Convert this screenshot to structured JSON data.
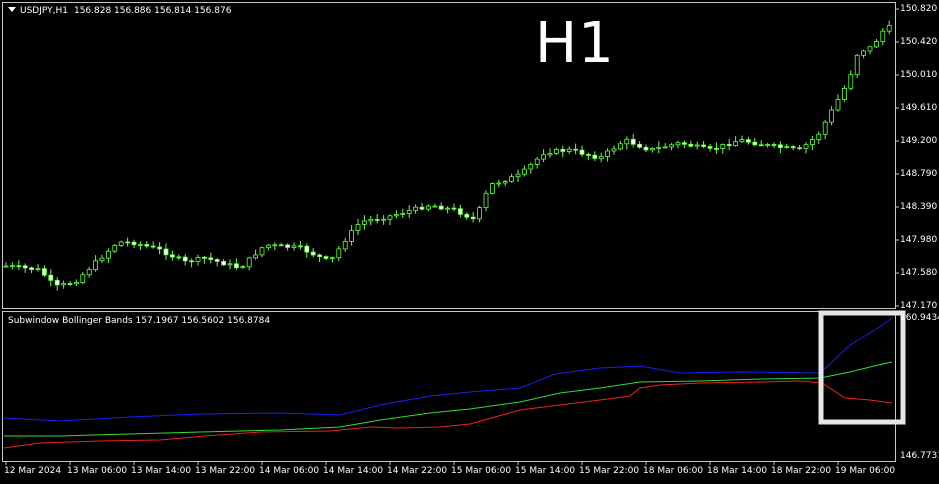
{
  "main_chart": {
    "symbol": "USDJPY,H1",
    "ohlc": "156.828 156.886 156.814 156.876",
    "timeframe_label": "H1",
    "y_ticks": [
      "150.820",
      "150.420",
      "150.010",
      "149.610",
      "149.200",
      "148.790",
      "148.390",
      "147.980",
      "147.580",
      "147.170"
    ]
  },
  "subwindow": {
    "title": "Subwindow Bollinger Bands",
    "values": "157.1967 156.5602 156.8784",
    "y_ticks": [
      "160.9434",
      "146.7731"
    ]
  },
  "x_ticks": [
    "12 Mar 2024",
    "13 Mar 06:00",
    "13 Mar 14:00",
    "13 Mar 22:00",
    "14 Mar 06:00",
    "14 Mar 14:00",
    "14 Mar 22:00",
    "15 Mar 06:00",
    "15 Mar 14:00",
    "15 Mar 22:00",
    "18 Mar 06:00",
    "18 Mar 14:00",
    "18 Mar 22:00",
    "19 Mar 06:00"
  ],
  "colors": {
    "candle": "#66ff44",
    "band_upper": "#1e1ef0",
    "band_middle": "#33dd33",
    "band_lower": "#ee2222",
    "highlight_box": "#e6e6e6"
  }
}
